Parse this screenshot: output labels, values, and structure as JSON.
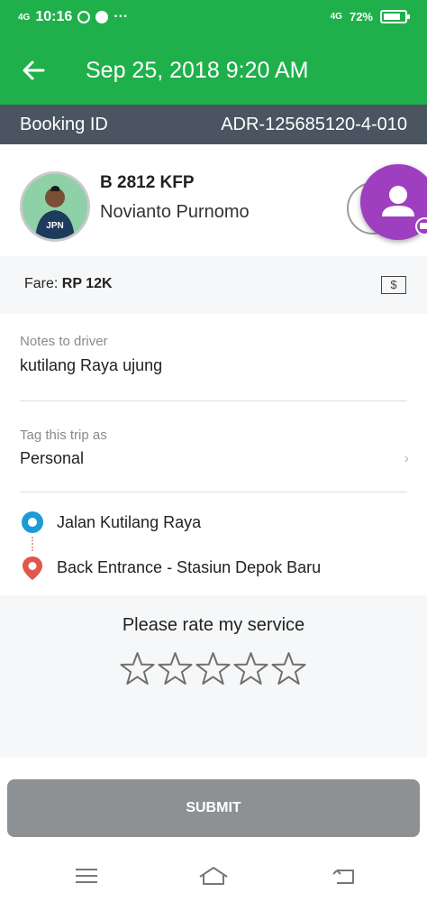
{
  "status_bar": {
    "network_left": "4G",
    "time": "10:16",
    "dots": "···",
    "network_right": "4G",
    "battery": "72%"
  },
  "app_bar": {
    "title": "Sep 25, 2018 9:20 AM"
  },
  "booking": {
    "label": "Booking ID",
    "value": "ADR-125685120-4-010"
  },
  "driver": {
    "plate": "B 2812 KFP",
    "name": "Novianto Purnomo",
    "shirt_text": "JPN"
  },
  "fare": {
    "label": "Fare:",
    "value": "RP 12K",
    "icon_glyph": "$"
  },
  "notes": {
    "label": "Notes to driver",
    "value": "kutilang Raya ujung"
  },
  "tag": {
    "label": "Tag this trip as",
    "value": "Personal"
  },
  "route": {
    "pickup": "Jalan Kutilang Raya",
    "dropoff": "Back Entrance - Stasiun Depok Baru"
  },
  "rating": {
    "prompt": "Please rate my service",
    "stars_filled": 0,
    "stars_total": 5
  },
  "submit_label": "SUBMIT",
  "colors": {
    "brand_green": "#1fb04b",
    "booking_bar": "#4a5561",
    "pickup_blue": "#1d9bd6",
    "dropoff_red": "#e0574b",
    "chat_purple": "#9d3fbf",
    "submit_disabled": "#8d9194"
  }
}
